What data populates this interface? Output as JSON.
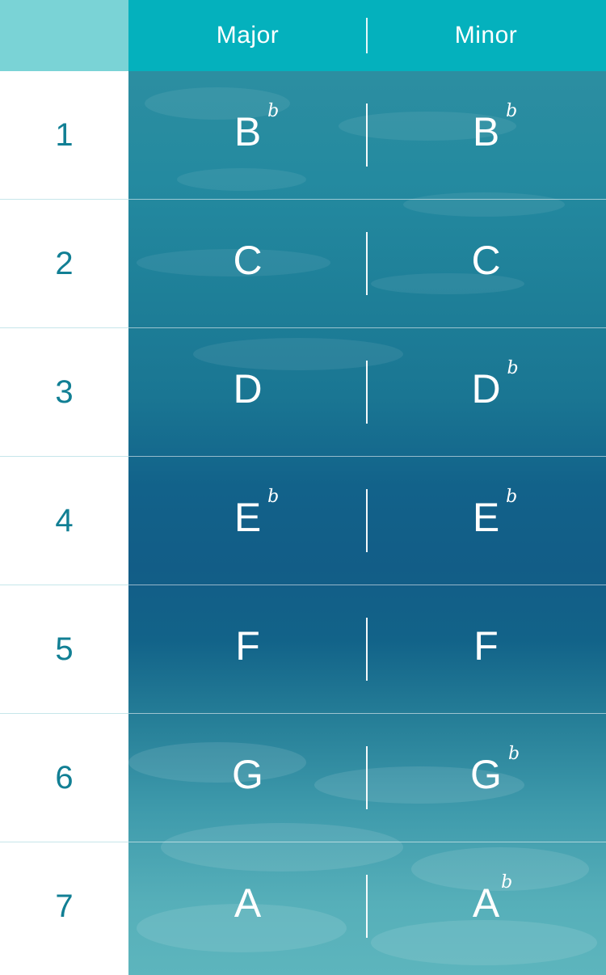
{
  "header": {
    "major_label": "Major",
    "minor_label": "Minor"
  },
  "rows": [
    {
      "number": "1",
      "major": {
        "letter": "B",
        "accidental": "b"
      },
      "minor": {
        "letter": "B",
        "accidental": "b"
      }
    },
    {
      "number": "2",
      "major": {
        "letter": "C",
        "accidental": ""
      },
      "minor": {
        "letter": "C",
        "accidental": ""
      }
    },
    {
      "number": "3",
      "major": {
        "letter": "D",
        "accidental": ""
      },
      "minor": {
        "letter": "D",
        "accidental": "b"
      }
    },
    {
      "number": "4",
      "major": {
        "letter": "E",
        "accidental": "b"
      },
      "minor": {
        "letter": "E",
        "accidental": "b"
      }
    },
    {
      "number": "5",
      "major": {
        "letter": "F",
        "accidental": ""
      },
      "minor": {
        "letter": "F",
        "accidental": ""
      }
    },
    {
      "number": "6",
      "major": {
        "letter": "G",
        "accidental": ""
      },
      "minor": {
        "letter": "G",
        "accidental": "b"
      }
    },
    {
      "number": "7",
      "major": {
        "letter": "A",
        "accidental": ""
      },
      "minor": {
        "letter": "A",
        "accidental": "b"
      }
    }
  ],
  "colors": {
    "header_bar": "#04b1bd",
    "header_corner": "#7ad3d6",
    "number_text": "#117f94"
  }
}
